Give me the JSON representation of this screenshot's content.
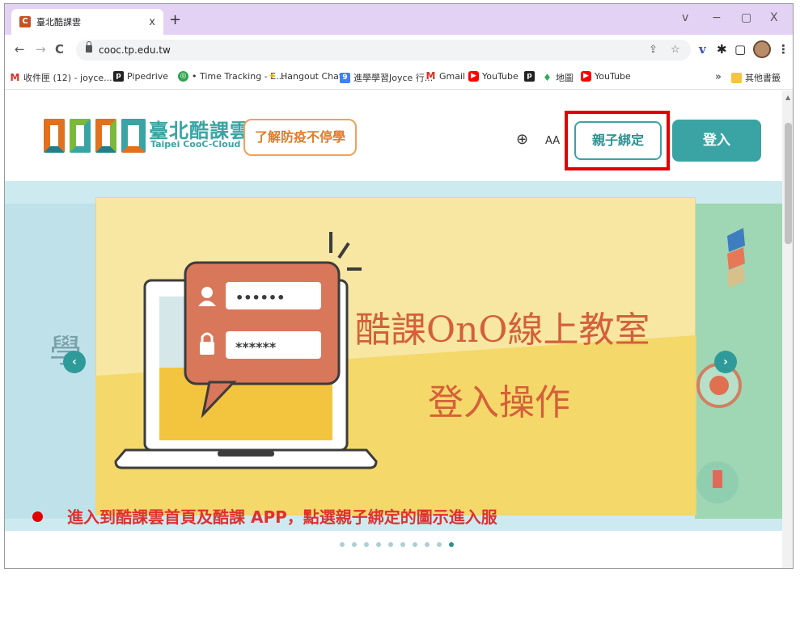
{
  "browser": {
    "tab_title": "臺北酷課雲",
    "tab_close": "x",
    "new_tab": "+",
    "window_controls": [
      "v",
      "−",
      "▢",
      "X"
    ],
    "url": "cooc.tp.edu.tw",
    "nav": {
      "back": "←",
      "forward": "→",
      "reload": "C"
    }
  },
  "bookmarks": [
    {
      "label": "收件匣 (12) - joyce....",
      "icon": "gmail-icon",
      "glyph": "M"
    },
    {
      "label": "Pipedrive",
      "icon": "pipedrive-icon",
      "glyph": "p"
    },
    {
      "label": "• Time Tracking - E...",
      "icon": "time-tracking-icon",
      "glyph": "◎"
    },
    {
      "label": "Hangout Chat",
      "icon": "hangout-icon",
      "glyph": "✦"
    },
    {
      "label": "進學學習Joyce 行...",
      "icon": "calendar-icon",
      "glyph": "9"
    },
    {
      "label": "Gmail",
      "icon": "gmail-icon",
      "glyph": "M"
    },
    {
      "label": "YouTube",
      "icon": "youtube-icon",
      "glyph": "▶"
    },
    {
      "label": "",
      "icon": "pipedrive-icon",
      "glyph": "p"
    },
    {
      "label": "地圖",
      "icon": "map-pin-icon",
      "glyph": "♦"
    },
    {
      "label": "YouTube",
      "icon": "youtube-icon",
      "glyph": "▶"
    }
  ],
  "bookmarks_overflow": "»",
  "other_bookmarks": "其他書籤",
  "site": {
    "logo_title": "臺北酷課雲",
    "logo_sub": "Taipei CooC-Cloud",
    "covid_button": "了解防疫不停學",
    "font_size_label": "AA",
    "bind_button": "親子綁定",
    "login_button": "登入"
  },
  "banner": {
    "headline": "酷課OnO線上教室",
    "subheadline": "登入操作",
    "password_1": "••••••",
    "password_2": "******",
    "left_peek_text": "學",
    "prev": "‹",
    "next": "›",
    "slide_count": 10,
    "active_slide": 10
  },
  "caption": "進入到酷課雲首頁及酷課 APP，點選親子綁定的圖示進入服",
  "colors": {
    "teal": "#3aa4a4",
    "orange": "#e07b2c",
    "highlight_red": "#e00000",
    "tab_strip": "#e4d2f5"
  }
}
